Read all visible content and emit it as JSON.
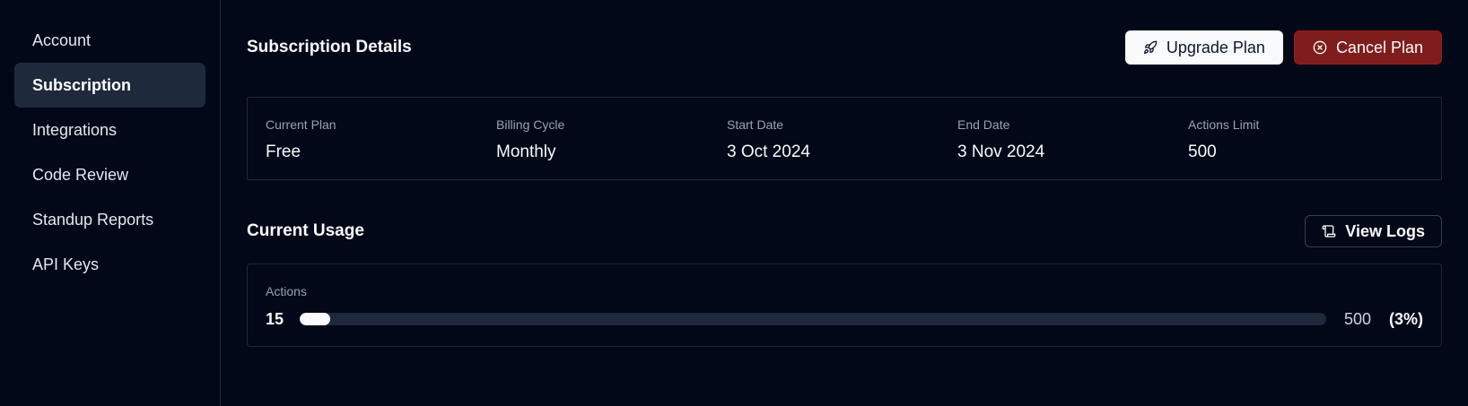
{
  "sidebar": {
    "items": [
      {
        "label": "Account",
        "active": false
      },
      {
        "label": "Subscription",
        "active": true
      },
      {
        "label": "Integrations",
        "active": false
      },
      {
        "label": "Code Review",
        "active": false
      },
      {
        "label": "Standup Reports",
        "active": false
      },
      {
        "label": "API Keys",
        "active": false
      }
    ]
  },
  "subscription": {
    "title": "Subscription Details",
    "upgrade_label": "Upgrade Plan",
    "upgrade_icon": "rocket-icon",
    "cancel_label": "Cancel Plan",
    "cancel_icon": "circle-x-icon",
    "details": [
      {
        "label": "Current Plan",
        "value": "Free"
      },
      {
        "label": "Billing Cycle",
        "value": "Monthly"
      },
      {
        "label": "Start Date",
        "value": "3 Oct 2024"
      },
      {
        "label": "End Date",
        "value": "3 Nov 2024"
      },
      {
        "label": "Actions Limit",
        "value": "500"
      }
    ]
  },
  "usage": {
    "title": "Current Usage",
    "view_logs_label": "View Logs",
    "view_logs_icon": "scroll-icon",
    "actions_label": "Actions",
    "current": "15",
    "limit": "500",
    "percent_text": "(3%)",
    "progress_fraction": 0.03
  },
  "colors": {
    "background": "#020817",
    "border": "#1e293b",
    "danger": "#7f1d1d",
    "muted_text": "#94a3b8"
  }
}
